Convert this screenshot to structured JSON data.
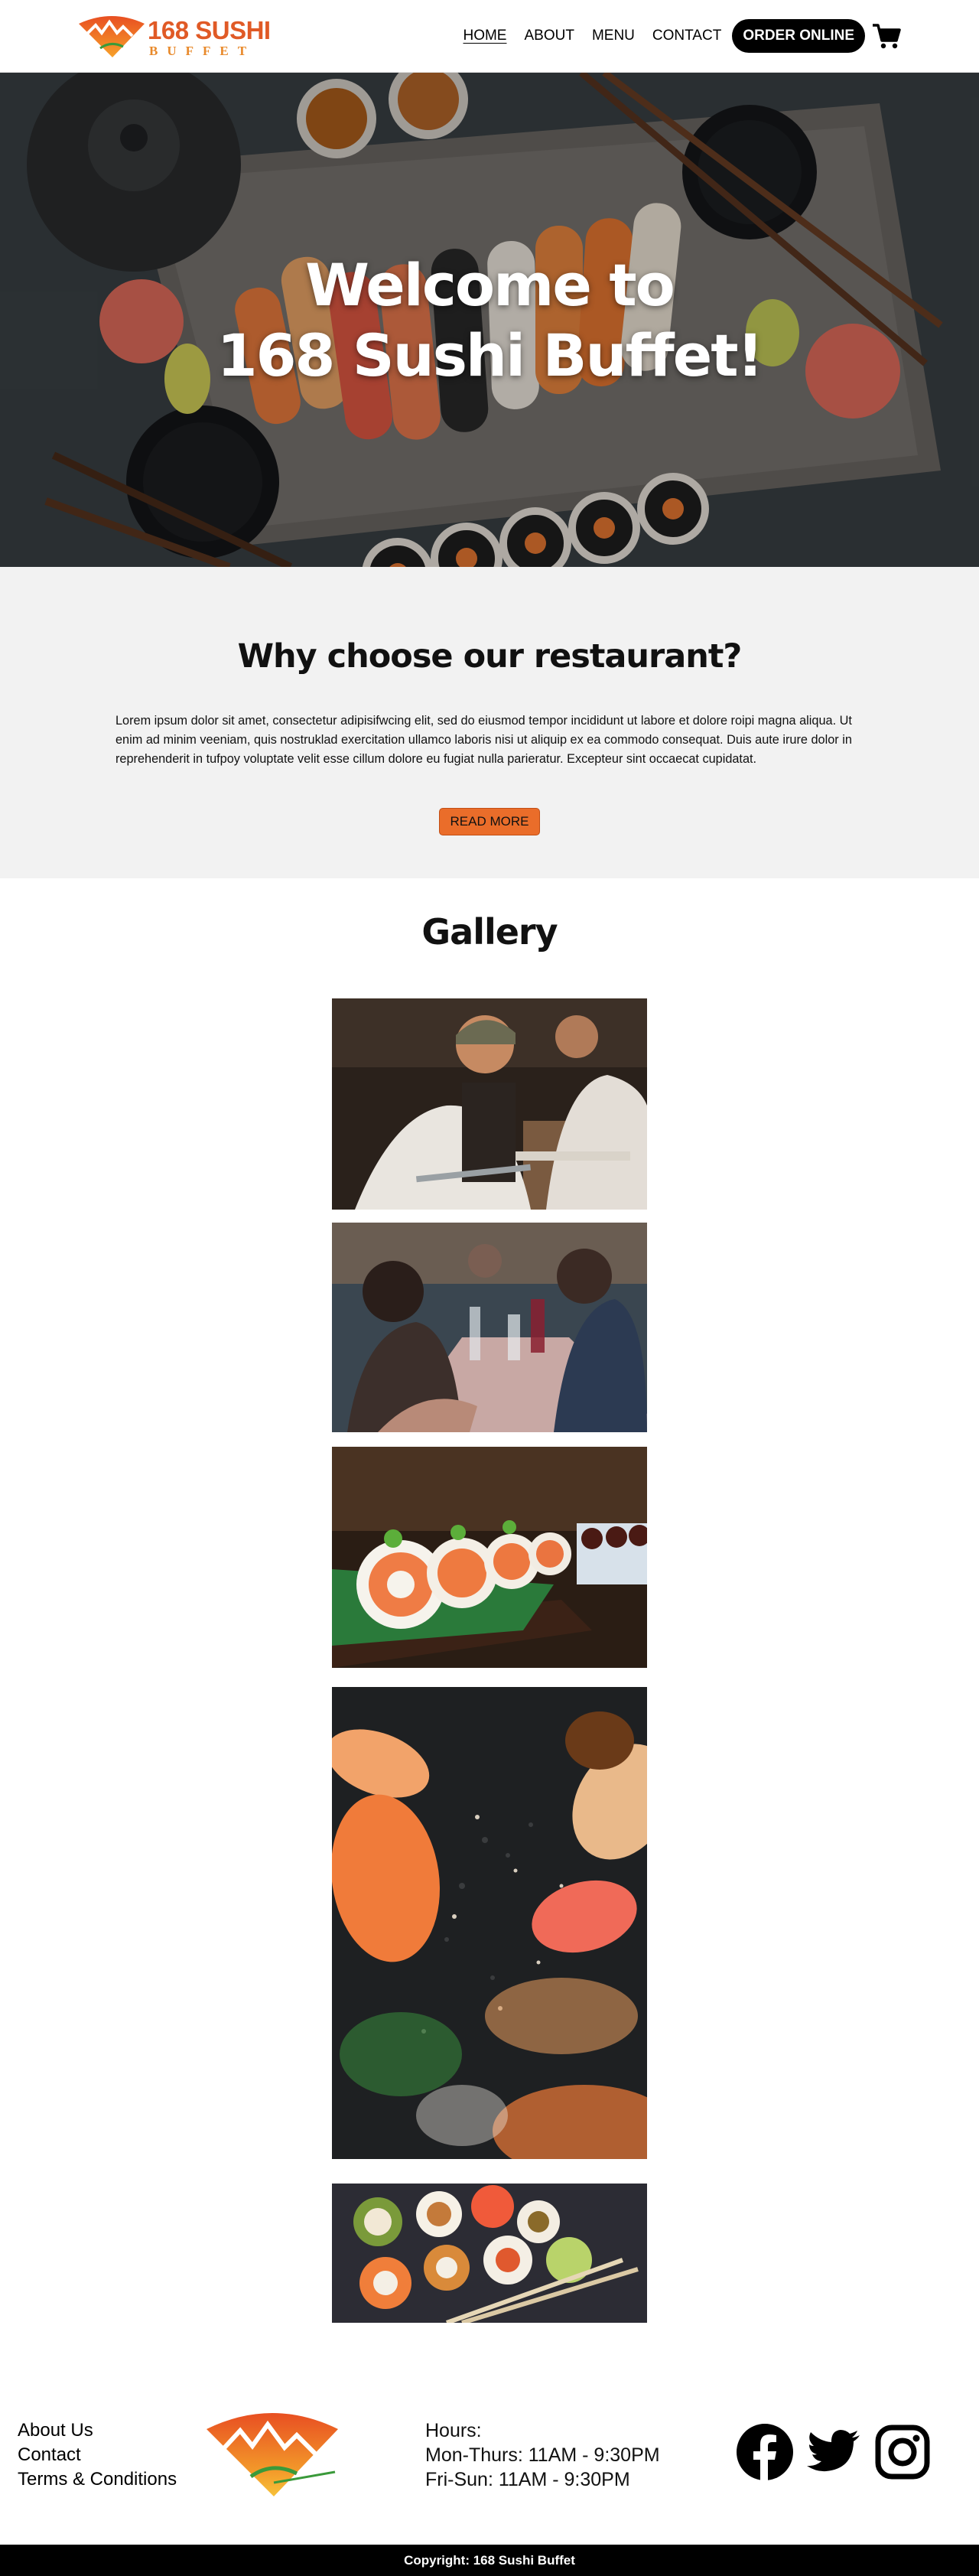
{
  "brand": {
    "name": "168 SUSHI",
    "sub": "BUFFET"
  },
  "nav": {
    "items": [
      {
        "label": "HOME",
        "active": true
      },
      {
        "label": "ABOUT"
      },
      {
        "label": "MENU"
      },
      {
        "label": "CONTACT"
      }
    ],
    "order_label": "ORDER ONLINE",
    "cart_icon": "shopping-cart-icon"
  },
  "hero": {
    "line1": "Welcome to",
    "line2": "168 Sushi Buffet!"
  },
  "why": {
    "heading": "Why choose our restaurant?",
    "body": "Lorem ipsum dolor sit amet, consectetur adipisifwcing elit, sed do eiusmod tempor incididunt ut labore et dolore roipi magna aliqua. Ut enim ad minim veeniam, quis nostruklad exercitation ullamco laboris nisi ut aliquip ex ea commodo consequat. Duis aute irure dolor in reprehenderit in tufpoy voluptate velit esse cillum dolore eu fugiat nulla parieratur. Excepteur sint occaecat cupidatat.",
    "button": "READ MORE"
  },
  "gallery": {
    "heading": "Gallery"
  },
  "footer": {
    "links": [
      "About Us",
      "Contact",
      "Terms & Conditions"
    ],
    "hours_title": "Hours:",
    "hours": [
      "Mon-Thurs: 11AM - 9:30PM",
      "Fri-Sun: 11AM - 9:30PM"
    ],
    "social_icons": [
      "facebook-icon",
      "twitter-icon",
      "instagram-icon"
    ],
    "copyright": "Copyright: 168 Sushi Buffet"
  },
  "colors": {
    "accent": "#ea6d2a",
    "brand": "#e05a26",
    "dark": "#000000",
    "panel": "#f2f2f2"
  }
}
